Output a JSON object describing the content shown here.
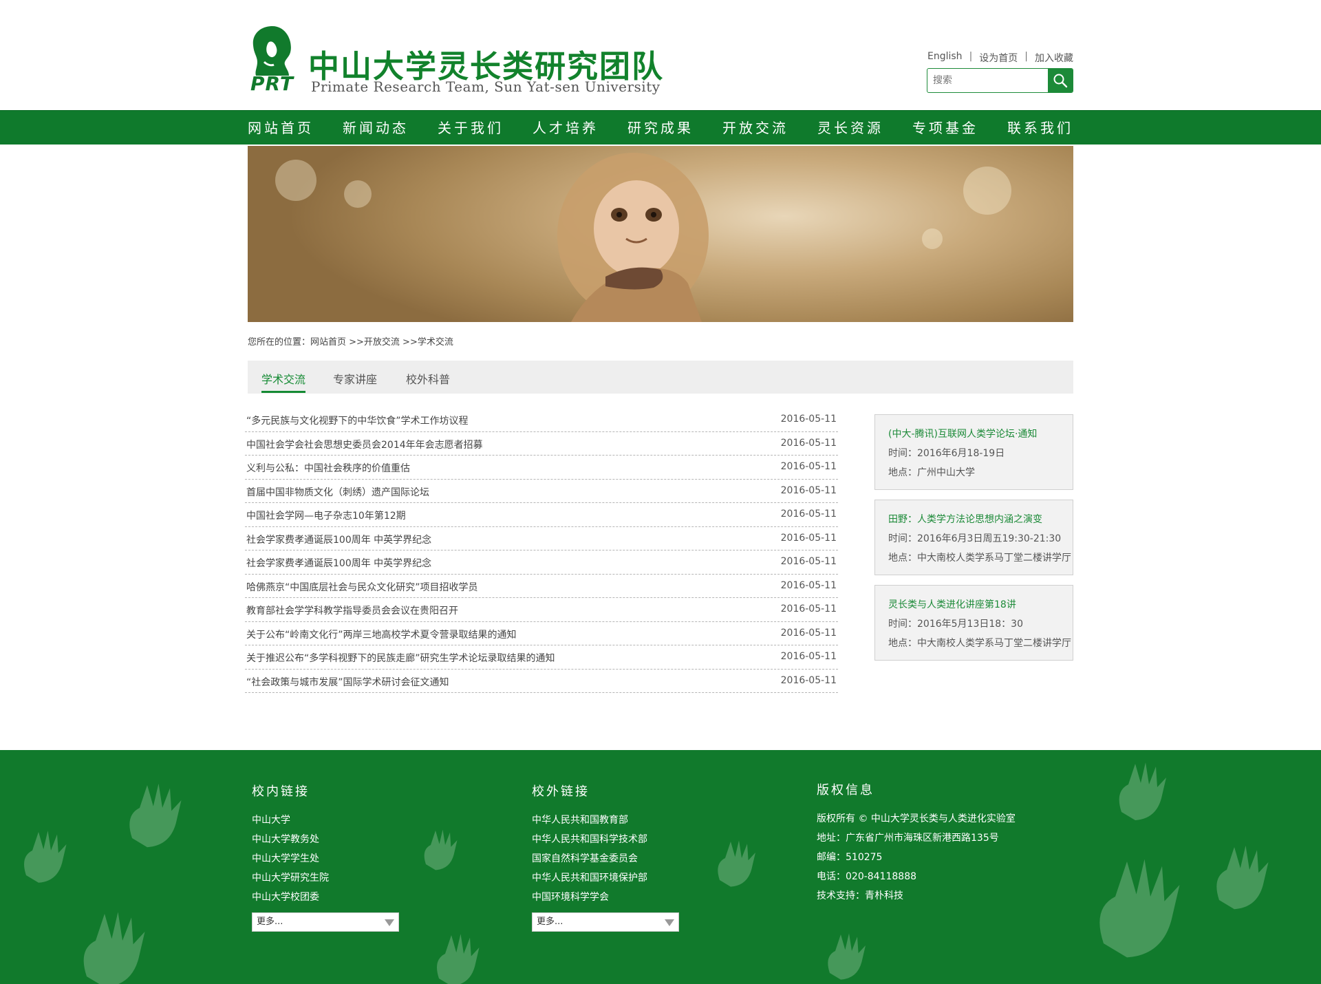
{
  "header": {
    "logo_text": "PRT",
    "title_cn": "中山大学灵长类研究团队",
    "title_en": "Primate Research Team, Sun Yat-sen University",
    "links": [
      "English",
      "设为首页",
      "加入收藏"
    ],
    "separator": "|",
    "search_placeholder": "搜索"
  },
  "nav": {
    "items": [
      "网站首页",
      "新闻动态",
      "关于我们",
      "人才培养",
      "研究成果",
      "开放交流",
      "灵长资源",
      "专项基金",
      "联系我们"
    ]
  },
  "breadcrumb": "您所在的位置：网站首页 >>开放交流 >>学术交流",
  "tabs": [
    "学术交流",
    "专家讲座",
    "校外科普"
  ],
  "news": [
    {
      "title": "“多元民族与文化视野下的中华饮食”学术工作坊议程",
      "date": "2016-05-11"
    },
    {
      "title": "中国社会学会社会思想史委员会2014年年会志愿者招募",
      "date": "2016-05-11"
    },
    {
      "title": "义利与公私：中国社会秩序的价值重估",
      "date": "2016-05-11"
    },
    {
      "title": "首届中国非物质文化（刺绣）遗产国际论坛",
      "date": "2016-05-11"
    },
    {
      "title": "中国社会学网—电子杂志10年第12期",
      "date": "2016-05-11"
    },
    {
      "title": "社会学家费孝通诞辰100周年 中英学界纪念",
      "date": "2016-05-11"
    },
    {
      "title": "社会学家费孝通诞辰100周年 中英学界纪念",
      "date": "2016-05-11"
    },
    {
      "title": "哈佛燕京“中国底层社会与民众文化研究”项目招收学员",
      "date": "2016-05-11"
    },
    {
      "title": "教育部社会学学科教学指导委员会会议在贵阳召开",
      "date": "2016-05-11"
    },
    {
      "title": "关于公布“岭南文化行”两岸三地高校学术夏令营录取结果的通知",
      "date": "2016-05-11"
    },
    {
      "title": "关于推迟公布“多学科视野下的民族走廊”研究生学术论坛录取结果的通知",
      "date": "2016-05-11"
    },
    {
      "title": "“社会政策与城市发展”国际学术研讨会征文通知",
      "date": "2016-05-11"
    }
  ],
  "events": [
    {
      "title": "(中大-腾讯)互联网人类学论坛·通知",
      "time": "时间：2016年6月18-19日",
      "place": "地点：广州中山大学"
    },
    {
      "title": "田野：人类学方法论思想内涵之演变",
      "time": "时间：2016年6月3日周五19:30-21:30",
      "place": "地点：中大南校人类学系马丁堂二楼讲学厅"
    },
    {
      "title": "灵长类与人类进化讲座第18讲",
      "time": "时间：2016年5月13日18：30",
      "place": "地点：中大南校人类学系马丁堂二楼讲学厅"
    }
  ],
  "footer": {
    "internal": {
      "heading": "校内链接",
      "links": [
        "中山大学",
        "中山大学教务处",
        "中山大学学生处",
        "中山大学研究生院",
        "中山大学校团委"
      ],
      "more": "更多..."
    },
    "external": {
      "heading": "校外链接",
      "links": [
        "中华人民共和国教育部",
        "中华人民共和国科学技术部",
        "国家自然科学基金委员会",
        "中华人民共和国环境保护部",
        "中国环境科学学会"
      ],
      "more": "更多..."
    },
    "copyright": {
      "heading": "版权信息",
      "lines": [
        "版权所有 © 中山大学灵长类与人类进化实验室",
        "地址：广东省广州市海珠区新港西路135号",
        "邮编：510275",
        "电话：020-84118888",
        "技术支持：青朴科技"
      ]
    }
  },
  "colors": {
    "brand_green": "#0f7a2c",
    "accent_green": "#1c8a38"
  }
}
